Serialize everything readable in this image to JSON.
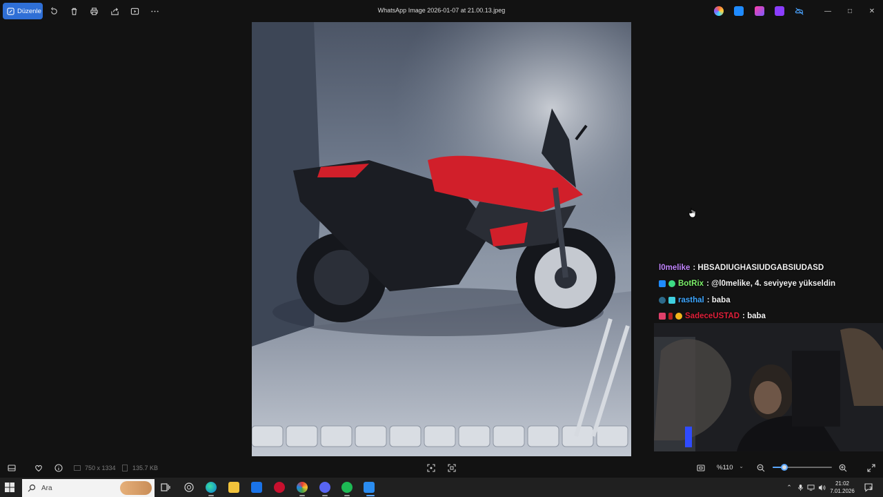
{
  "app": {
    "title": "WhatsApp Image 2026-01-07 at 21.00.13.jpeg",
    "edit_label": "Düzenle"
  },
  "toolbar": {
    "icons": [
      "edit-icon",
      "rotate-icon",
      "delete-icon",
      "print-icon",
      "share-icon",
      "slideshow-icon",
      "more-icon"
    ]
  },
  "chat": {
    "messages": [
      {
        "user": "l0melike",
        "text": ": HBSADIUGHASIUDGABSIUDASD",
        "color": "#c084fc"
      },
      {
        "user": "BotRix",
        "text": ": @l0melike, 4. seviyeye yükseldin",
        "color": "#7cf06a"
      },
      {
        "user": "rasthal",
        "text": ": baba",
        "color": "#3da6ff"
      },
      {
        "user": "SadeceUSTAD",
        "text": ": baba",
        "color": "#e0203a"
      }
    ]
  },
  "status": {
    "dimensions": "750 x 1334",
    "filesize": "135.7 KB",
    "zoom": "%110",
    "zoom_fraction": 0.2
  },
  "taskbar": {
    "search_placeholder": "Ara",
    "time": "21:02",
    "date": "7.01.2026",
    "notification_count": "3"
  },
  "colors": {
    "accent": "#2f6fd6",
    "background": "#121212",
    "bike_red": "#d11f2a"
  }
}
